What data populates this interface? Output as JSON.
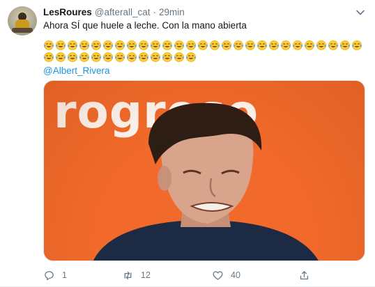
{
  "tweet": {
    "display_name": "LesRoures",
    "handle": "@afterall_cat",
    "separator": "·",
    "time": "29min",
    "text": "Ahora SÍ que huele a leche. Con la mano abierta",
    "emoji_name": "face-with-tears-of-joy-icon",
    "emoji_row1_count": 27,
    "emoji_row2_count": 13,
    "mention": "@Albert_Rivera",
    "media": {
      "banner_text": "rogreso",
      "background_color": "#f26a2b"
    },
    "actions": {
      "reply_count": "1",
      "retweet_count": "12",
      "like_count": "40"
    }
  },
  "colors": {
    "link": "#1b95e0",
    "secondary": "#657786",
    "emoji_face": "#ffcc33",
    "emoji_tears": "#5dadec"
  }
}
